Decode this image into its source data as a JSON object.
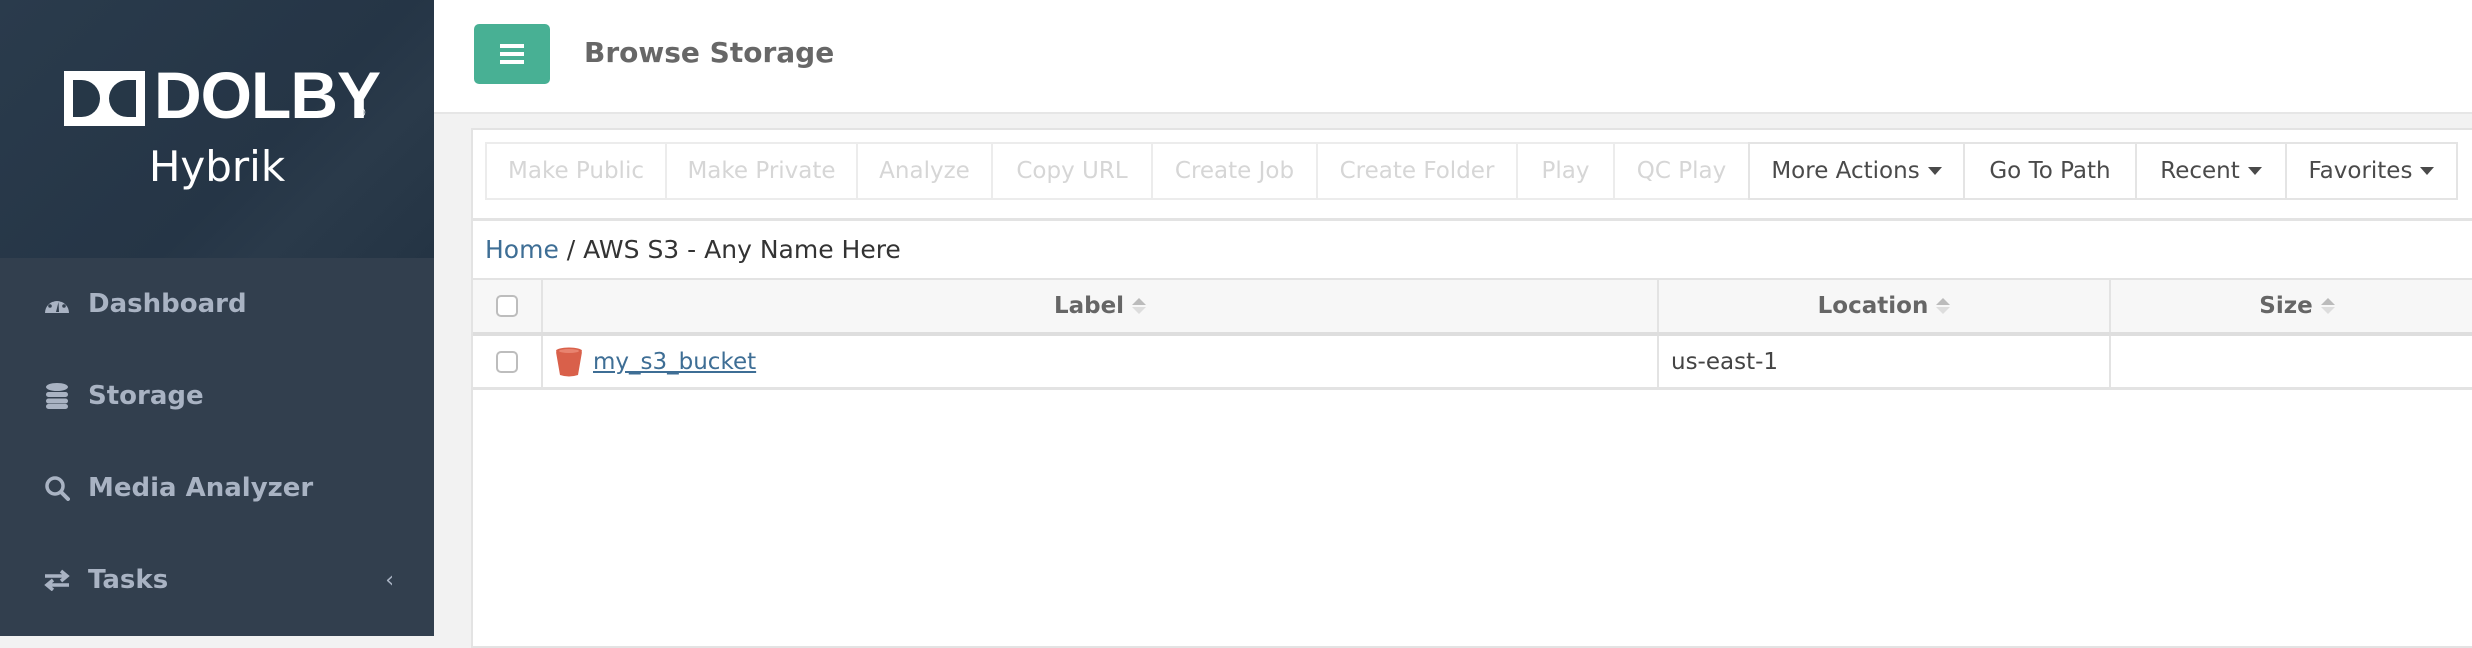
{
  "brand": {
    "logo_text": "DOLBY",
    "registered": "®",
    "product": "Hybrik"
  },
  "sidebar": {
    "items": [
      {
        "label": "Dashboard",
        "icon": "dashboard-gauge-icon"
      },
      {
        "label": "Storage",
        "icon": "database-icon"
      },
      {
        "label": "Media Analyzer",
        "icon": "search-icon"
      },
      {
        "label": "Tasks",
        "icon": "exchange-arrows-icon",
        "expand": "‹"
      }
    ]
  },
  "header": {
    "menu_icon": "hamburger-icon",
    "title": "Browse Storage",
    "accent_color": "#48b094"
  },
  "toolbar": {
    "buttons": [
      {
        "label": "Make Public",
        "enabled": false
      },
      {
        "label": "Make Private",
        "enabled": false
      },
      {
        "label": "Analyze",
        "enabled": false
      },
      {
        "label": "Copy URL",
        "enabled": false
      },
      {
        "label": "Create Job",
        "enabled": false
      },
      {
        "label": "Create Folder",
        "enabled": false
      },
      {
        "label": "Play",
        "enabled": false
      },
      {
        "label": "QC Play",
        "enabled": false
      },
      {
        "label": "More Actions",
        "enabled": true,
        "dropdown": true
      },
      {
        "label": "Go To Path",
        "enabled": true
      },
      {
        "label": "Recent",
        "enabled": true,
        "dropdown": true
      },
      {
        "label": "Favorites",
        "enabled": true,
        "dropdown": true
      }
    ]
  },
  "breadcrumb": {
    "home": "Home",
    "separator": "/",
    "current": "AWS S3 - Any Name Here"
  },
  "table": {
    "columns": [
      "Label",
      "Location",
      "Size"
    ],
    "rows": [
      {
        "label": "my_s3_bucket",
        "icon": "s3-bucket-icon",
        "location": "us-east-1",
        "size": "",
        "checked": false
      }
    ]
  }
}
